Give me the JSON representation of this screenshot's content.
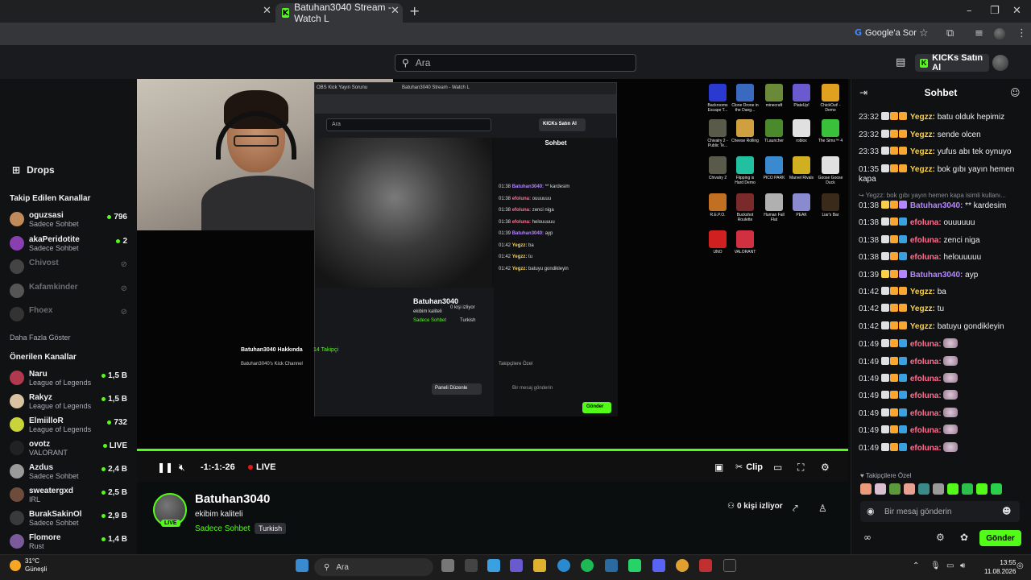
{
  "browser": {
    "tab_title": "Batuhan3040 Stream - Watch L",
    "new_tab": "+",
    "google_ask": "Google'a Sor"
  },
  "header": {
    "search_placeholder": "Ara",
    "buy_label": "KICKs Satın Al"
  },
  "sidebar": {
    "drops": "Drops",
    "following_title": "Takip Edilen Kanallar",
    "following": [
      {
        "name": "oguzsasi",
        "sub": "Sadece Sohbet",
        "count": "796",
        "color": "#c08a5a"
      },
      {
        "name": "akaPeridotite",
        "sub": "Sadece Sohbet",
        "count": "2",
        "color": "#8a3fb0"
      },
      {
        "name": "Chivost",
        "sub": "",
        "count": "",
        "color": "#444"
      },
      {
        "name": "Kafamkinder",
        "sub": "",
        "count": "",
        "color": "#555"
      },
      {
        "name": "Fhoex",
        "sub": "",
        "count": "",
        "color": "#333"
      }
    ],
    "show_more": "Daha Fazla Göster",
    "recommended_title": "Önerilen Kanallar",
    "recommended": [
      {
        "name": "Naru",
        "sub": "League of Legends",
        "count": "1,5 B",
        "color": "#b0394e"
      },
      {
        "name": "Rakyz",
        "sub": "League of Legends",
        "count": "1,5 B",
        "color": "#d9c2a0"
      },
      {
        "name": "ElmiilloR",
        "sub": "League of Legends",
        "count": "732",
        "color": "#c8d43a"
      },
      {
        "name": "ovotz",
        "sub": "VALORANT",
        "count": "LIVE",
        "color": "#222"
      },
      {
        "name": "Azdus",
        "sub": "Sadece Sohbet",
        "count": "2,4 B",
        "color": "#9a9a9a"
      },
      {
        "name": "sweatergxd",
        "sub": "IRL",
        "count": "2,5 B",
        "color": "#6e4b3a"
      },
      {
        "name": "BurakSakinOl",
        "sub": "Sadece Sohbet",
        "count": "2,9 B",
        "color": "#3a3a3a"
      },
      {
        "name": "Flomore",
        "sub": "Rust",
        "count": "1,4 B",
        "color": "#7a5a9a"
      }
    ]
  },
  "nested": {
    "tab1": "OBS Kick Yayın Sorunu",
    "tab2": "Batuhan3040 Stream - Watch L",
    "search": "Ara",
    "buy": "KICKs Satın Al",
    "chat_title": "Sohbet",
    "lines": [
      {
        "t": "01:38",
        "u": "Batuhan3040:",
        "m": "** kardesim"
      },
      {
        "t": "01:38",
        "u": "efoluna:",
        "m": "ouuuuuu"
      },
      {
        "t": "01:38",
        "u": "efoluna:",
        "m": "zenci niga"
      },
      {
        "t": "01:38",
        "u": "efoluna:",
        "m": "helouuuuu"
      },
      {
        "t": "01:39",
        "u": "Batuhan3040:",
        "m": "ayp"
      },
      {
        "t": "01:42",
        "u": "Yegzz:",
        "m": "ba"
      },
      {
        "t": "01:42",
        "u": "Yegzz:",
        "m": "tu"
      },
      {
        "t": "01:42",
        "u": "Yegzz:",
        "m": "batuyu gondikleyin"
      }
    ],
    "name": "Batuhan3040",
    "title": "ekibim kaliteli",
    "category": "Sadece Sohbet",
    "lang": "Turkish",
    "viewers": "0 kişi izliyor",
    "about": "Batuhan3040 Hakkında",
    "about_count": "14 Takipçi",
    "about_desc": "Batuhan3040's Kick Channel",
    "panel_btn": "Paneli Düzenle",
    "input": "Bir mesaj gönderin",
    "send": "Gönder",
    "followers_only": "Takipçilere Özel"
  },
  "desktop_icons": [
    {
      "label": "Backrooms Escape T...",
      "color": "#2a3ad0"
    },
    {
      "label": "Clone Drone in the Dang...",
      "color": "#3a6ac0"
    },
    {
      "label": "minecraft",
      "color": "#6a8a3a"
    },
    {
      "label": "PlateUp!",
      "color": "#6a5ad0"
    },
    {
      "label": "ChickOut! - Demo",
      "color": "#e0a020"
    },
    {
      "label": "Chivalry 2 - Public Te...",
      "color": "#5a5a4a"
    },
    {
      "label": "Cheese Rolling",
      "color": "#d0a040"
    },
    {
      "label": "TLauncher",
      "color": "#4a8a2a"
    },
    {
      "label": "roblox",
      "color": "#e0e0e0"
    },
    {
      "label": "The Sims™ 4",
      "color": "#3ac03a"
    },
    {
      "label": "Chivalry 2",
      "color": "#5a5a4a"
    },
    {
      "label": "Flipping is Hard Demo",
      "color": "#20c0a0"
    },
    {
      "label": "PICO PARK",
      "color": "#3a8ad0"
    },
    {
      "label": "Marvel Rivals",
      "color": "#d0b020"
    },
    {
      "label": "Goose Goose Duck",
      "color": "#e0e0e0"
    },
    {
      "label": "R.E.P.O.",
      "color": "#c07020"
    },
    {
      "label": "Buckshot Roulette",
      "color": "#7a2a2a"
    },
    {
      "label": "Human Fall Flat",
      "color": "#b0b0b0"
    },
    {
      "label": "PEAK",
      "color": "#8a8ad0"
    },
    {
      "label": "Liar's Bar",
      "color": "#3a2a1a"
    },
    {
      "label": "UNO",
      "color": "#d02020"
    },
    {
      "label": "VALORANT",
      "color": "#d03040"
    }
  ],
  "player": {
    "time": "-1:-1:-26",
    "live": "LIVE",
    "clip": "Clip"
  },
  "stream": {
    "name": "Batuhan3040",
    "title": "ekibim kaliteli",
    "category": "Sadece Sohbet",
    "lang": "Turkish",
    "viewers": "0 kişi izliyor",
    "live_badge": "LIVE"
  },
  "chat": {
    "title": "Sohbet",
    "messages": [
      {
        "time": "23:32",
        "user": "Yegzz:",
        "cls": "u-y",
        "text": "batu olduk hepimiz"
      },
      {
        "time": "23:32",
        "user": "Yegzz:",
        "cls": "u-y",
        "text": "sende olcen"
      },
      {
        "time": "23:33",
        "user": "Yegzz:",
        "cls": "u-y",
        "text": "yufus abı tek oynuyo"
      },
      {
        "time": "01:35",
        "user": "Yegzz:",
        "cls": "u-y",
        "text": "bok gıbı yayın hemen"
      }
    ],
    "wrap_text": "kapa",
    "reply_text": "↪ Yegzz: bok gıbı yayın hemen kapa isimli kullanı...",
    "messages2": [
      {
        "time": "01:38",
        "user": "Batuhan3040:",
        "cls": "u-b",
        "text": "** kardesim"
      },
      {
        "time": "01:38",
        "user": "efoluna:",
        "cls": "u-e",
        "text": "ouuuuuu"
      },
      {
        "time": "01:38",
        "user": "efoluna:",
        "cls": "u-e",
        "text": "zenci niga"
      },
      {
        "time": "01:38",
        "user": "efoluna:",
        "cls": "u-e",
        "text": "helouuuuu"
      },
      {
        "time": "01:39",
        "user": "Batuhan3040:",
        "cls": "u-b",
        "text": "ayp"
      },
      {
        "time": "01:42",
        "user": "Yegzz:",
        "cls": "u-y",
        "text": "ba"
      },
      {
        "time": "01:42",
        "user": "Yegzz:",
        "cls": "u-y",
        "text": "tu"
      },
      {
        "time": "01:42",
        "user": "Yegzz:",
        "cls": "u-y",
        "text": "batuyu gondikleyin"
      },
      {
        "time": "01:49",
        "user": "efoluna:",
        "cls": "u-e",
        "text": ""
      },
      {
        "time": "01:49",
        "user": "efoluna:",
        "cls": "u-e",
        "text": ""
      },
      {
        "time": "01:49",
        "user": "efoluna:",
        "cls": "u-e",
        "text": ""
      },
      {
        "time": "01:49",
        "user": "efoluna:",
        "cls": "u-e",
        "text": ""
      },
      {
        "time": "01:49",
        "user": "efoluna:",
        "cls": "u-e",
        "text": ""
      },
      {
        "time": "01:49",
        "user": "efoluna:",
        "cls": "u-e",
        "text": ""
      },
      {
        "time": "01:49",
        "user": "efoluna:",
        "cls": "u-e",
        "text": ""
      }
    ],
    "followers_only": "Takipçilere Özel",
    "input_placeholder": "Bir mesaj gönderin",
    "send": "Gönder"
  },
  "taskbar": {
    "temp": "31°C",
    "weather": "Güneşli",
    "search": "Ara",
    "time": "13:55",
    "date": "11.08.2026"
  },
  "colors": {
    "accent": "#53fc18",
    "bg": "#0b0e0f"
  }
}
